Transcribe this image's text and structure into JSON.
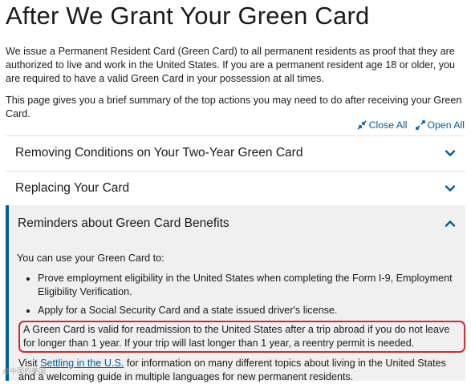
{
  "page": {
    "title": "After We Grant Your Green Card",
    "intro": "We issue a Permanent Resident Card (Green Card) to all permanent residents as proof that they are authorized to live and work in the United States. If you are a permanent resident age 18 or older, you are required to have a valid Green Card in your possession at all times.",
    "summary": "This page gives you a brief summary of the top actions you may need to do after receiving your Green Card."
  },
  "controls": {
    "close_all": "Close All",
    "open_all": "Open All"
  },
  "accordion": {
    "items": [
      {
        "label": "Removing Conditions on Your Two-Year Green Card",
        "expanded": false
      },
      {
        "label": "Replacing Your Card",
        "expanded": false
      },
      {
        "label": "Reminders about Green Card Benefits",
        "expanded": true
      }
    ],
    "body": {
      "lead": "You can use your Green Card to:",
      "bullets": [
        "Prove employment eligibility in the United States when completing the Form I-9, Employment Eligibility Verification.",
        "Apply for a Social Security Card and a state issued driver's license."
      ],
      "highlight": "A Green Card is valid for readmission to the United States after a trip abroad if you do not leave for longer than 1 year. If your trip will last longer than 1 year, a reentry permit is needed.",
      "visit_prefix": "Visit ",
      "visit_link": "Settling in the U.S.",
      "visit_suffix": " for information on many different topics about living in the United States and a welcoming guide in multiple languages for new permanent residents."
    }
  },
  "watermark": "@中国的美国"
}
